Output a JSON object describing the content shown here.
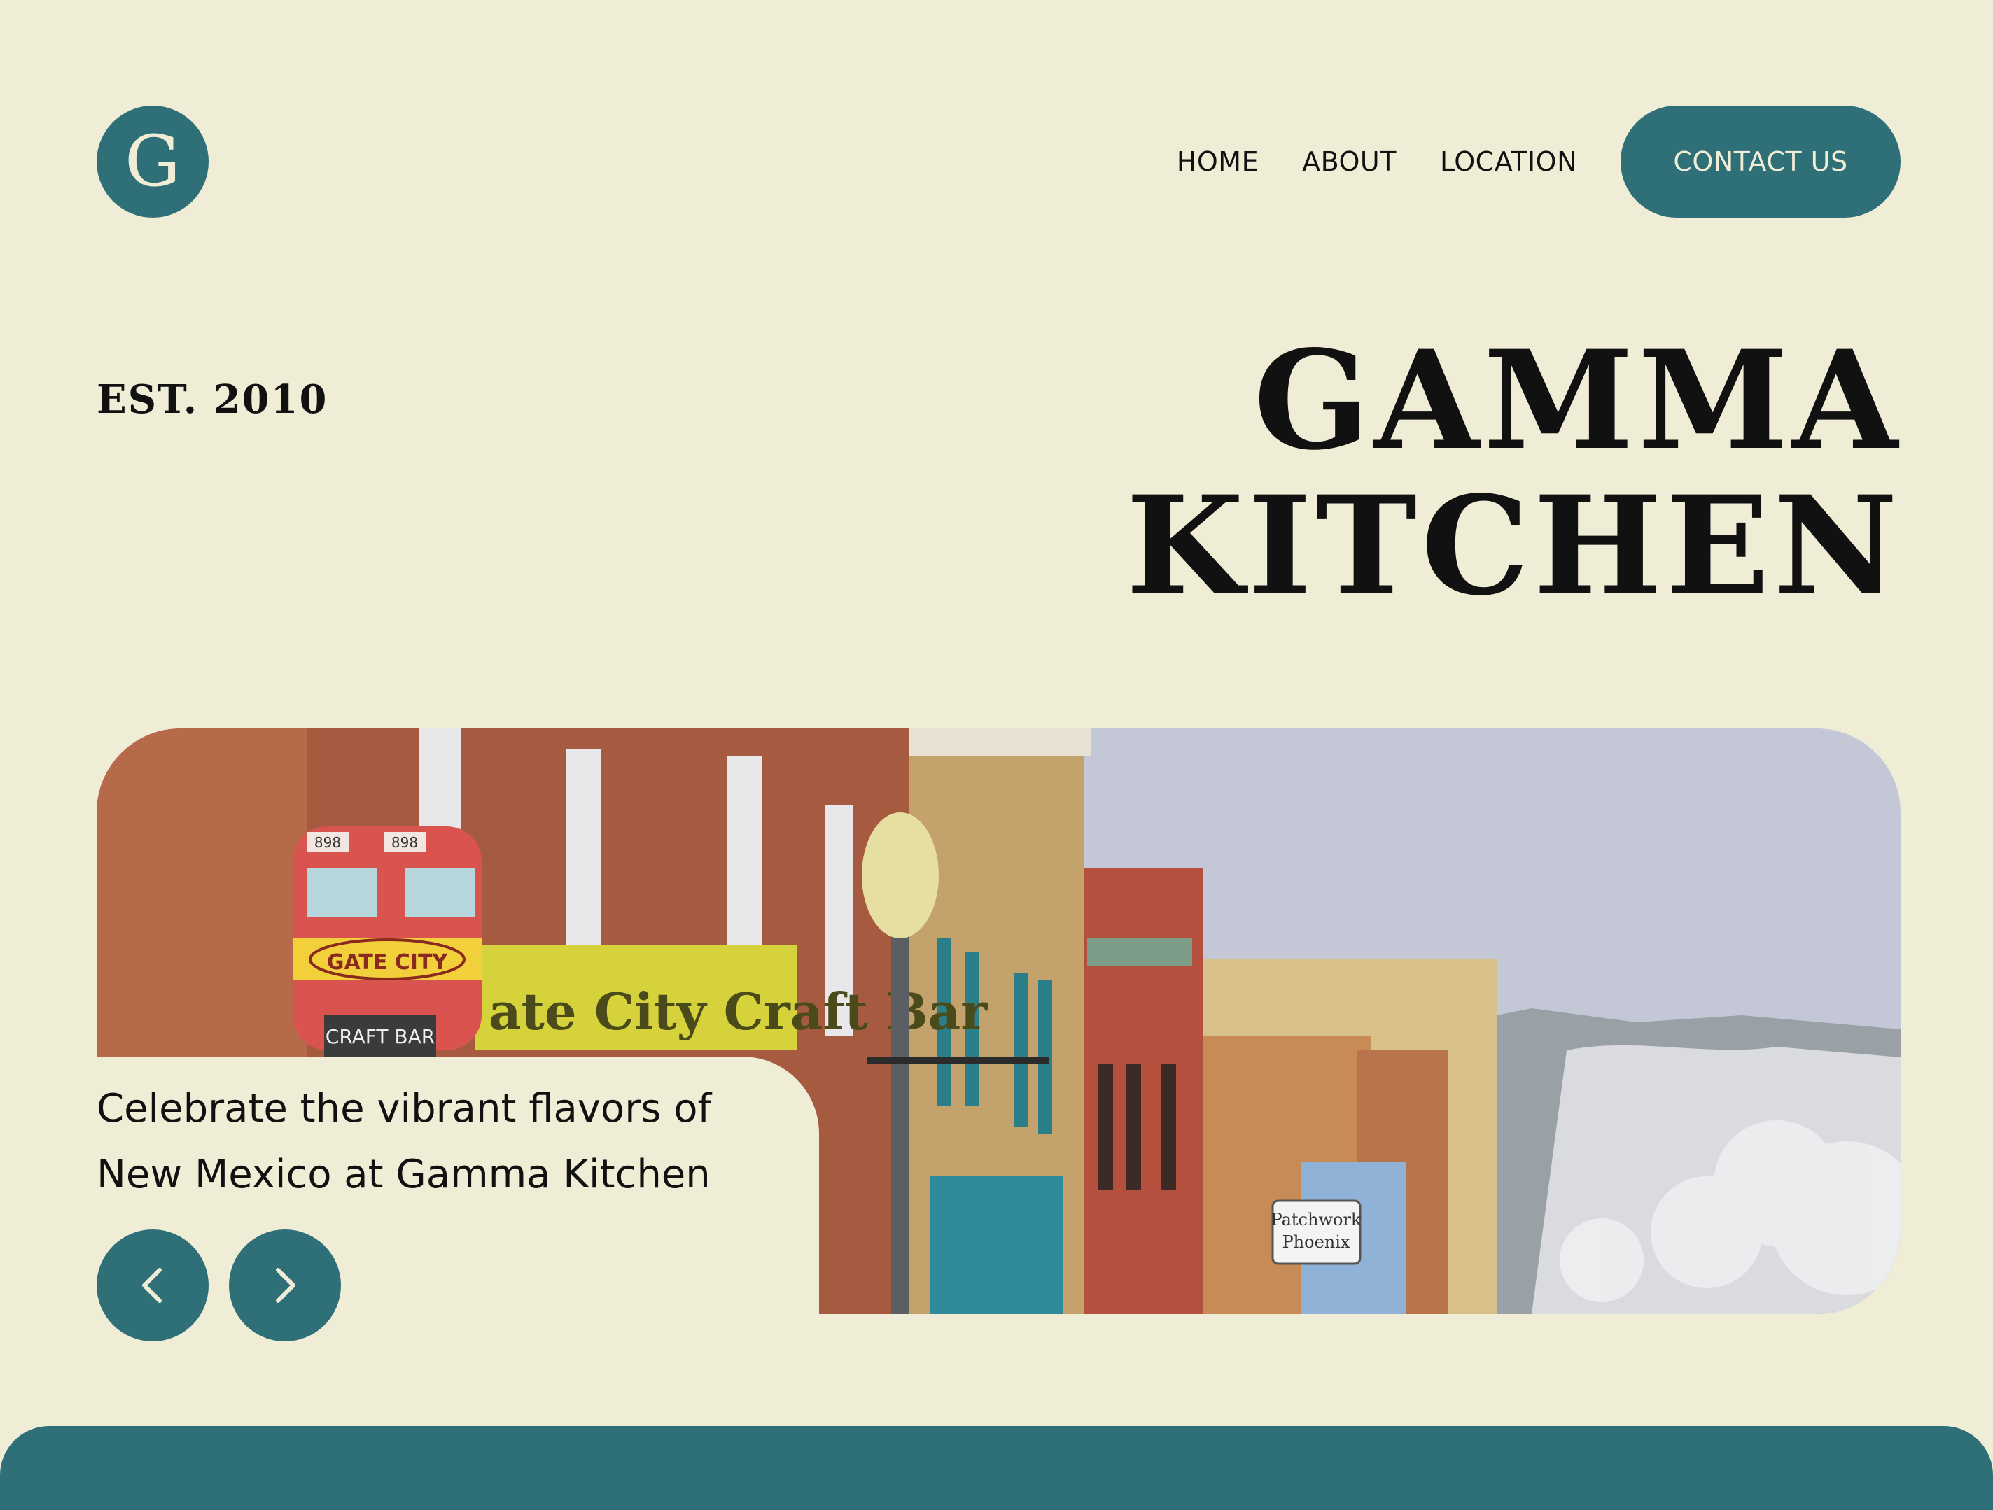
{
  "logo": {
    "letter": "G"
  },
  "nav": {
    "items": [
      {
        "label": "HOME"
      },
      {
        "label": "ABOUT"
      },
      {
        "label": "LOCATION"
      }
    ],
    "contact_label": "CONTACT US"
  },
  "hero": {
    "established": "EST. 2010",
    "title_line1": "GAMMA",
    "title_line2": "KITCHEN",
    "image_alt": "Historic downtown street with brick storefronts, Gate City Craft Bar sign with locomotive mural, Patchwork Phoenix shop sign and snowy mesa",
    "caption": "Celebrate the vibrant flavors of New Mexico at Gamma Kitchen",
    "sign_texts": [
      "GATE CITY",
      "898",
      "898",
      "CRAFT BAR",
      "ate City Craft Bar",
      "Patchwork",
      "Phoenix"
    ]
  },
  "carousel": {
    "prev_icon": "chevron-left-icon",
    "next_icon": "chevron-right-icon"
  },
  "colors": {
    "background": "#efedd6",
    "accent": "#2e6f78",
    "text": "#111111"
  }
}
